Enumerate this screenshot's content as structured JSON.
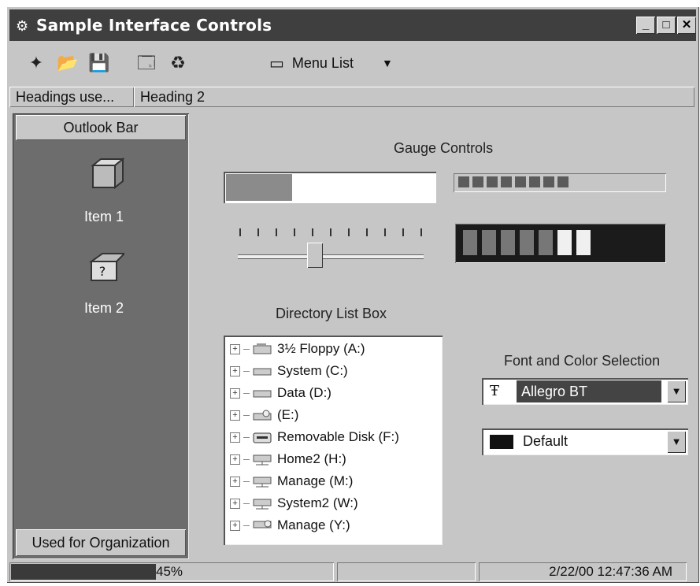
{
  "window": {
    "title": "Sample Interface Controls",
    "controls": {
      "minimize": "_",
      "maximize": "□",
      "close": "✕"
    }
  },
  "toolbar": {
    "menu_list_label": "Menu List",
    "icons": [
      "new-icon",
      "open-icon",
      "save-icon",
      "properties-icon",
      "recycle-icon"
    ]
  },
  "headers": [
    "Headings use...",
    "Heading 2"
  ],
  "outlook": {
    "bar_title": "Outlook Bar",
    "items": [
      {
        "label": "Item 1"
      },
      {
        "label": "Item 2"
      }
    ],
    "footer": "Used for Organization"
  },
  "gauges": {
    "title": "Gauge Controls",
    "bar_progress": 0.32,
    "blocks_filled": 8,
    "led_segments_total": 7,
    "led_segments_active": 7,
    "slider_value": 0.4
  },
  "directory": {
    "title": "Directory List Box",
    "items": [
      "3½ Floppy (A:)",
      "System (C:)",
      "Data (D:)",
      "(E:)",
      "Removable Disk (F:)",
      "Home2 (H:)",
      "Manage (M:)",
      "System2 (W:)",
      "Manage (Y:)"
    ]
  },
  "font_color": {
    "title": "Font and Color Selection",
    "font_value": "Allegro BT",
    "color_value": "Default",
    "font_icon": "truetype-icon"
  },
  "status": {
    "progress_percent": 45,
    "progress_label": "45%",
    "datetime": "2/22/00 12:47:36 AM"
  }
}
